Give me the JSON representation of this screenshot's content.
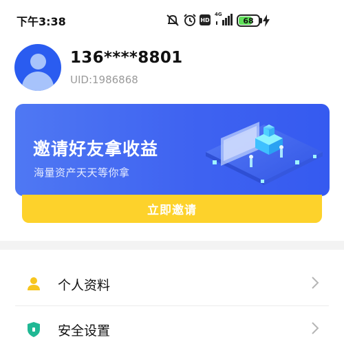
{
  "status_bar": {
    "time": "下午3:38",
    "network": "4G",
    "hd_badge": "HD",
    "battery_percent": 68,
    "battery_label": "68",
    "icons": [
      "mute-alarm-icon",
      "alarm-clock-icon",
      "hd-icon",
      "signal-icon",
      "battery-icon",
      "charging-icon"
    ]
  },
  "profile": {
    "phone": "136****8801",
    "uid": "UID:1986868"
  },
  "banner": {
    "title": "邀请好友拿收益",
    "subtitle": "海量资产天天等你拿",
    "button_label": "立即邀请",
    "colors": {
      "banner": "#3f63f1",
      "button": "#fdd22b"
    }
  },
  "menu": {
    "items": [
      {
        "label": "个人资料",
        "icon": "person-icon",
        "icon_color": "#f7c51e"
      },
      {
        "label": "安全设置",
        "icon": "shield-icon",
        "icon_color": "#20b894"
      }
    ]
  }
}
